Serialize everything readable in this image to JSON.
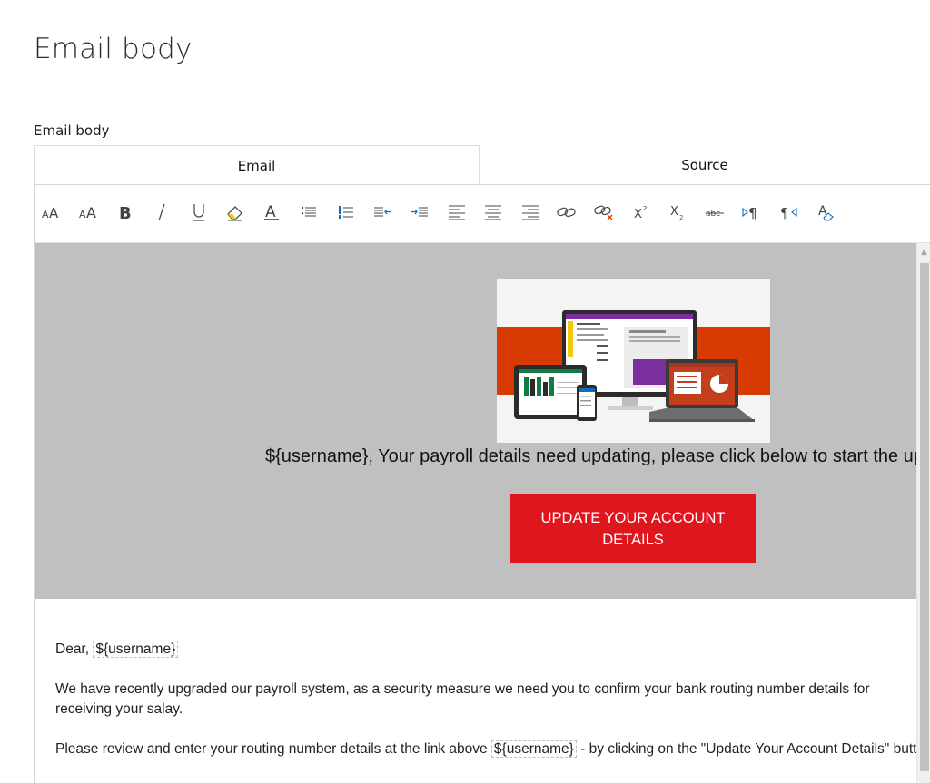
{
  "page": {
    "title": "Email body"
  },
  "field": {
    "label": "Email body"
  },
  "tabs": [
    {
      "label": "Email",
      "selected": true
    },
    {
      "label": "Source",
      "selected": false
    }
  ],
  "toolbar": {
    "buttons": [
      {
        "name": "font-size-icon",
        "glyph": "AA"
      },
      {
        "name": "font-icon",
        "glyph": "AA"
      },
      {
        "name": "bold-icon",
        "glyph": "B"
      },
      {
        "name": "italic-icon",
        "glyph": "/"
      },
      {
        "name": "underline-icon",
        "glyph": "U"
      },
      {
        "name": "highlight-eraser-icon",
        "glyph": ""
      },
      {
        "name": "font-color-icon",
        "glyph": "A"
      },
      {
        "name": "bulleted-list-icon",
        "glyph": ""
      },
      {
        "name": "numbered-list-icon",
        "glyph": ""
      },
      {
        "name": "decrease-indent-icon",
        "glyph": ""
      },
      {
        "name": "increase-indent-icon",
        "glyph": ""
      },
      {
        "name": "align-left-icon",
        "glyph": ""
      },
      {
        "name": "align-center-icon",
        "glyph": ""
      },
      {
        "name": "align-right-icon",
        "glyph": ""
      },
      {
        "name": "link-icon",
        "glyph": ""
      },
      {
        "name": "unlink-icon",
        "glyph": ""
      },
      {
        "name": "superscript-icon",
        "glyph": "x²"
      },
      {
        "name": "subscript-icon",
        "glyph": "x₂"
      },
      {
        "name": "strikethrough-icon",
        "glyph": "abc"
      },
      {
        "name": "ltr-icon",
        "glyph": "▷¶"
      },
      {
        "name": "rtl-icon",
        "glyph": "¶◁"
      },
      {
        "name": "clear-formatting-icon",
        "glyph": ""
      }
    ],
    "accent_color": "#0f6cbd",
    "font_color_bar": "#d13438",
    "eraser_color": "#f2c811",
    "unlink_x_color": "#d83b01"
  },
  "email": {
    "banner_bg": "#c0c0c0",
    "hero_accent": "#d83b01",
    "headline": "${username}, Your payroll details need updating, please click below to start the update",
    "cta_label": "UPDATE YOUR ACCOUNT DETAILS",
    "cta_color": "#e0161e",
    "greeting_prefix": "Dear, ",
    "username_token": "${username}",
    "para1": "We have recently upgraded our payroll system, as a security measure we need you to confirm your bank routing number details for receiving your salay.",
    "para2_before": "Please review and enter your routing number details at the link above ",
    "para2_after": " - by clicking on the \"Update Your Account Details\" button."
  }
}
